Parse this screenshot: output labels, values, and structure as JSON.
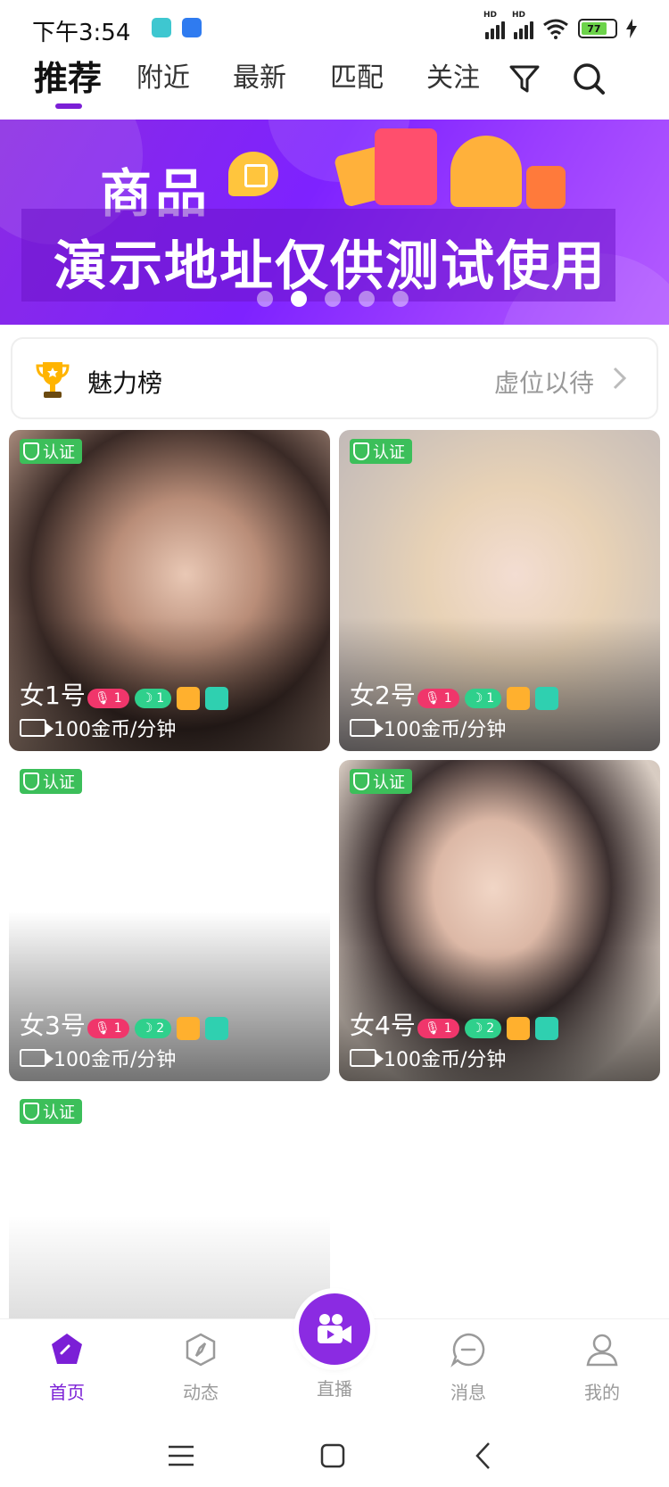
{
  "status_bar": {
    "time": "下午3:54",
    "signal_label": "HD",
    "battery_level": "77"
  },
  "top_nav": {
    "tabs": [
      {
        "label": "推荐",
        "active": true
      },
      {
        "label": "附近",
        "active": false
      },
      {
        "label": "最新",
        "active": false
      },
      {
        "label": "匹配",
        "active": false
      },
      {
        "label": "关注",
        "active": false
      }
    ],
    "icons": [
      "filter-icon",
      "search-icon"
    ]
  },
  "banner": {
    "title": "商品",
    "subtitle": "演示地址仅供测试使用",
    "page_count": 5,
    "current_page": 2
  },
  "charm_list": {
    "label": "魅力榜",
    "value": "虚位以待",
    "icon": "trophy-icon"
  },
  "cards": [
    {
      "verified": "认证",
      "name": "女1号",
      "badge_red": "1",
      "badge_green": "1",
      "price": "100金币/分钟"
    },
    {
      "verified": "认证",
      "name": "女2号",
      "badge_red": "1",
      "badge_green": "1",
      "price": "100金币/分钟"
    },
    {
      "verified": "认证",
      "name": "女3号",
      "badge_red": "1",
      "badge_green": "2",
      "price": "100金币/分钟"
    },
    {
      "verified": "认证",
      "name": "女4号",
      "badge_red": "1",
      "badge_green": "2",
      "price": "100金币/分钟"
    },
    {
      "verified": "认证"
    }
  ],
  "bottom_nav": {
    "items": [
      {
        "label": "首页",
        "active": true
      },
      {
        "label": "动态",
        "active": false
      },
      {
        "label": "直播",
        "active": false
      },
      {
        "label": "消息",
        "active": false
      },
      {
        "label": "我的",
        "active": false
      }
    ]
  },
  "colors": {
    "accent": "#7b1fd6",
    "banner": "#8a2be2",
    "verified": "#3cbf5a",
    "badge_red": "#f0366b",
    "badge_green": "#2fd08c"
  }
}
